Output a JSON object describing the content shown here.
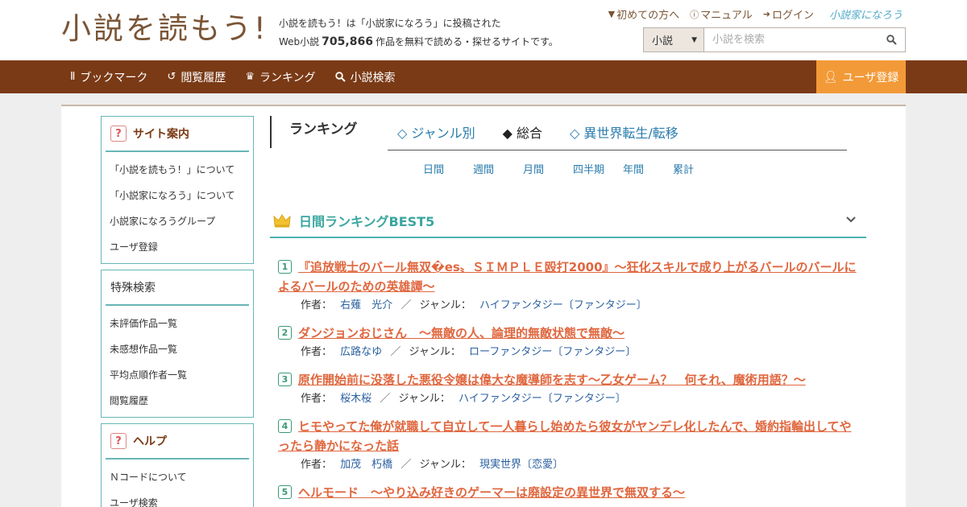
{
  "header": {
    "logo_text": "小説を読もう!",
    "tagline_line1": "小説を読もう！は「小説家になろう」に投稿された",
    "tagline_prefix": "Web小説",
    "tagline_count": "705,866",
    "tagline_suffix": "作品を無料で読める・探せるサイトです。",
    "top_links": [
      {
        "icon": "beginner-icon",
        "label": "初めての方へ"
      },
      {
        "icon": "help-icon",
        "label": "マニュアル"
      },
      {
        "icon": "login-icon",
        "label": "ログイン"
      }
    ],
    "partner_logo": "小説家になろう",
    "search": {
      "select_value": "小説",
      "placeholder": "小説を検索"
    }
  },
  "nav": {
    "items": [
      {
        "icon": "bookmark-icon",
        "label": "ブックマーク"
      },
      {
        "icon": "history-icon",
        "label": "閲覧履歴"
      },
      {
        "icon": "crown-icon",
        "label": "ランキング"
      },
      {
        "icon": "search-icon",
        "label": "小説検索"
      }
    ],
    "register_label": "ユーザ登録"
  },
  "sidebar": {
    "site_guide": {
      "title": "サイト案内",
      "items": [
        "「小説を読もう！」について",
        "「小説家になろう」について",
        "小説家になろうグループ",
        "ユーザ登録"
      ]
    },
    "special_search": {
      "title": "特殊検索",
      "items": [
        "未評価作品一覧",
        "未感想作品一覧",
        "平均点順作者一覧",
        "閲覧履歴"
      ]
    },
    "help": {
      "title": "ヘルプ",
      "items": [
        "Ｎコードについて",
        "ユーザ検索"
      ]
    }
  },
  "ranking": {
    "title": "ランキング",
    "tabs": [
      {
        "label": "◇ ジャンル別",
        "active": false
      },
      {
        "label": "◆ 総合",
        "active": true
      },
      {
        "label": "◇ 異世界転生/転移",
        "active": false
      }
    ],
    "periods": [
      "日間",
      "週間",
      "月間",
      "四半期",
      "年間",
      "累計"
    ],
    "best_title": "日間ランキングBEST5",
    "author_label": "作者：",
    "genre_label": "ジャンル：",
    "separator": "／",
    "entries": [
      {
        "rank": "1",
        "title": "『追放戦士のバール無双�es〟ＳＩＭＰＬＥ殴打2000』～狂化スキルで成り上がるバールのバールによるバールのための英雄譚～",
        "author": "右薙　光介",
        "genre": "ハイファンタジー〔ファンタジー〕"
      },
      {
        "rank": "2",
        "title": "ダンジョンおじさん　～無敵の人、論理的無敵状態で無敵～",
        "author": "広路なゆ",
        "genre": "ローファンタジー〔ファンタジー〕"
      },
      {
        "rank": "3",
        "title": "原作開始前に没落した悪役令嬢は偉大な魔導師を志す～乙女ゲーム？　何それ、魔術用語？～",
        "author": "桜木桜",
        "genre": "ハイファンタジー〔ファンタジー〕"
      },
      {
        "rank": "4",
        "title": "ヒモやってた俺が就職して自立して一人暮らし始めたら彼女がヤンデレ化したんで、婚約指輪出してやったら静かになった話",
        "author": "加茂　朽橋",
        "genre": "現実世界〔恋愛〕"
      },
      {
        "rank": "5",
        "title": "ヘルモード　～やり込み好きのゲーマーは廃設定の異世界で無双する～",
        "author": "",
        "genre": ""
      }
    ]
  },
  "colors": {
    "brand_brown": "#7a3a16",
    "logo_brown": "#7a5536",
    "accent_orange": "#f39a38",
    "teal": "#4cb5ae",
    "title_orange": "#e0673f",
    "link_blue": "#2a5fa0"
  }
}
